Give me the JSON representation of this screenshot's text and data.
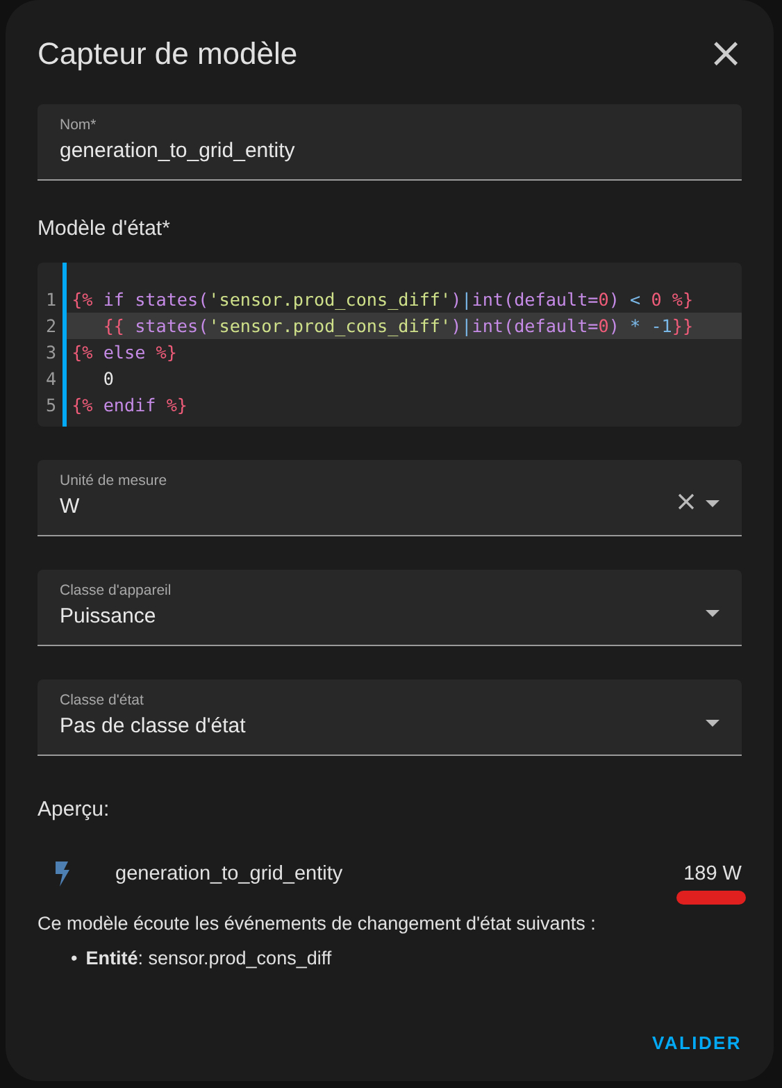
{
  "dialog": {
    "title": "Capteur de modèle",
    "close": "×"
  },
  "name_field": {
    "label": "Nom*",
    "value": "generation_to_grid_entity"
  },
  "template": {
    "label": "Modèle d'état*",
    "lines": [
      {
        "number": "1",
        "active": false,
        "tokens": [
          {
            "kind": "delim",
            "text": "{%"
          },
          {
            "kind": "kw",
            "text": " if states("
          },
          {
            "kind": "str",
            "text": "'sensor.prod_cons_diff'"
          },
          {
            "kind": "kw",
            "text": ")"
          },
          {
            "kind": "op",
            "text": "|"
          },
          {
            "kind": "kw",
            "text": "int(default="
          },
          {
            "kind": "num",
            "text": "0"
          },
          {
            "kind": "kw",
            "text": ") "
          },
          {
            "kind": "op",
            "text": "<"
          },
          {
            "kind": "num",
            "text": " 0 %}"
          }
        ]
      },
      {
        "number": "2",
        "active": true,
        "tokens": [
          {
            "kind": "delim",
            "text": "   {{"
          },
          {
            "kind": "kw",
            "text": " states("
          },
          {
            "kind": "str",
            "text": "'sensor.prod_cons_diff'"
          },
          {
            "kind": "kw",
            "text": ")"
          },
          {
            "kind": "op",
            "text": "|"
          },
          {
            "kind": "kw",
            "text": "int(default="
          },
          {
            "kind": "num",
            "text": "0"
          },
          {
            "kind": "kw",
            "text": ") "
          },
          {
            "kind": "op",
            "text": "* -1"
          },
          {
            "kind": "delim",
            "text": "}}"
          }
        ]
      },
      {
        "number": "3",
        "active": false,
        "tokens": [
          {
            "kind": "delim",
            "text": "{%"
          },
          {
            "kind": "kw",
            "text": " else "
          },
          {
            "kind": "delim",
            "text": "%}"
          }
        ]
      },
      {
        "number": "4",
        "active": false,
        "tokens": [
          {
            "kind": "plain",
            "text": "   0"
          }
        ]
      },
      {
        "number": "5",
        "active": false,
        "tokens": [
          {
            "kind": "delim",
            "text": "{%"
          },
          {
            "kind": "kw",
            "text": " endif "
          },
          {
            "kind": "delim",
            "text": "%}"
          }
        ]
      }
    ]
  },
  "selects": [
    {
      "label": "Unité de mesure",
      "value": "W",
      "clearable": true
    },
    {
      "label": "Classe d'appareil",
      "value": "Puissance",
      "clearable": false
    },
    {
      "label": "Classe d'état",
      "value": "Pas de classe d'état",
      "clearable": false
    }
  ],
  "preview": {
    "heading": "Aperçu:",
    "entity": "generation_to_grid_entity",
    "state": "189 W",
    "state_marked": true,
    "listens": "Ce modèle écoute les événements de changement d'état suivants :",
    "items": [
      {
        "bullet": "•",
        "text": "**Entité**: sensor.prod_cons_diff"
      }
    ]
  },
  "buttons": [
    "VALIDER"
  ]
}
